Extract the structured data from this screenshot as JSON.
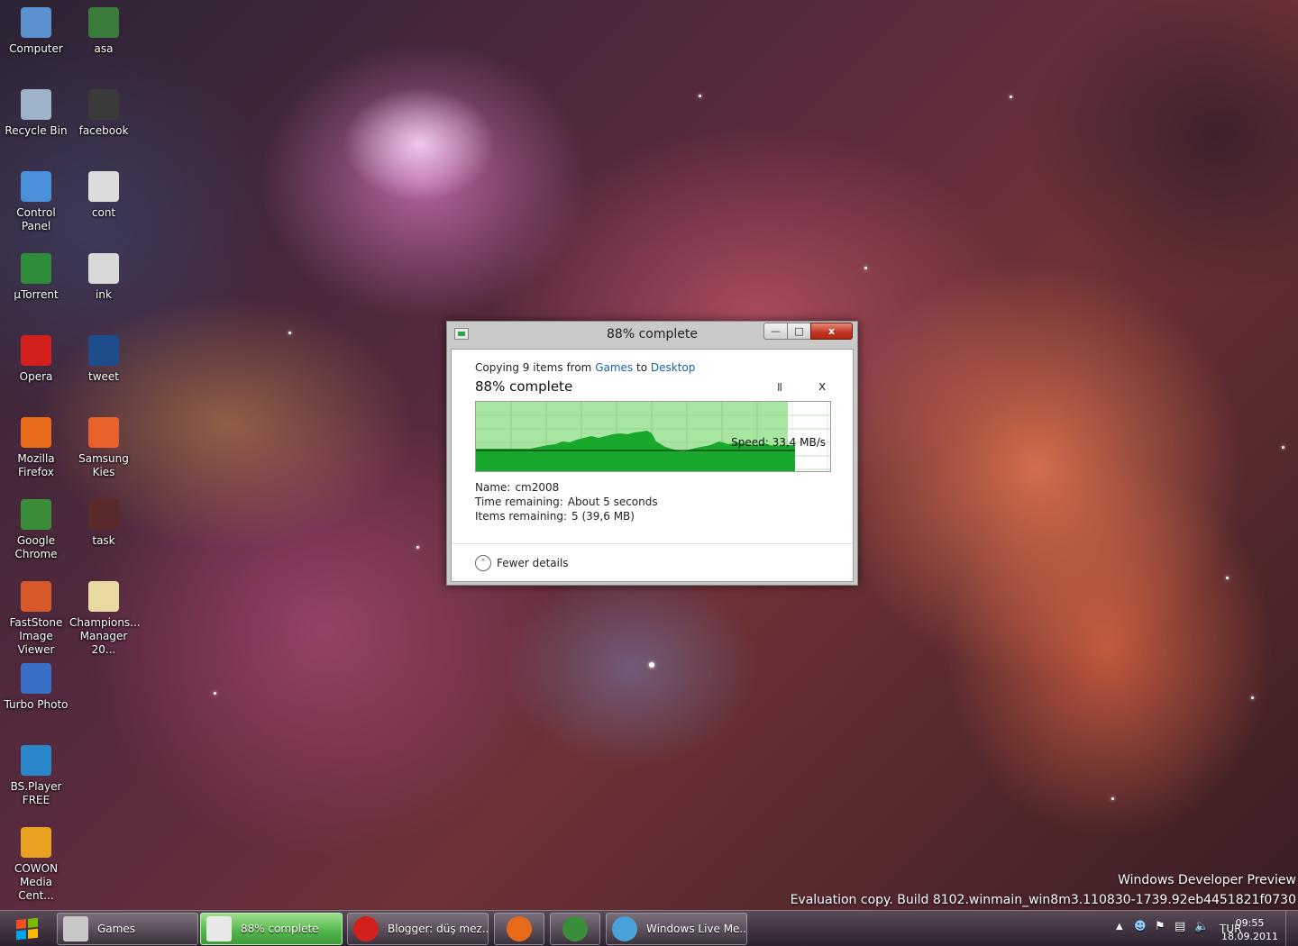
{
  "desktop": {
    "icons_col1": [
      {
        "label": "Computer",
        "icon": "computer-icon",
        "color": "#5a8fd0"
      },
      {
        "label": "Recycle Bin",
        "icon": "recycle-bin-icon",
        "color": "#9fb3c8"
      },
      {
        "label": "Control Panel",
        "icon": "control-panel-icon",
        "color": "#4a90d9"
      },
      {
        "label": "µTorrent",
        "icon": "utorrent-icon",
        "color": "#2e8b3a"
      },
      {
        "label": "Opera",
        "icon": "opera-icon",
        "color": "#d3201c"
      },
      {
        "label": "Mozilla Firefox",
        "icon": "firefox-icon",
        "color": "#e86b1c"
      },
      {
        "label": "Google Chrome",
        "icon": "chrome-icon",
        "color": "#3c8d3a"
      },
      {
        "label": "FastStone Image Viewer",
        "icon": "faststone-icon",
        "color": "#d85a2a"
      },
      {
        "label": "Turbo Photo",
        "icon": "turbo-photo-icon",
        "color": "#3a6fc8"
      },
      {
        "label": "BS.Player FREE",
        "icon": "bsplayer-icon",
        "color": "#2a86c8"
      },
      {
        "label": "COWON Media Cent...",
        "icon": "cowon-icon",
        "color": "#e8a020"
      }
    ],
    "icons_col2": [
      {
        "label": "asa",
        "icon": "image-file-icon",
        "color": "#3a7a3a"
      },
      {
        "label": "facebook",
        "icon": "image-file-icon",
        "color": "#3a3a3a"
      },
      {
        "label": "cont",
        "icon": "image-file-icon",
        "color": "#dcdcdc"
      },
      {
        "label": "ink",
        "icon": "image-file-icon",
        "color": "#d8d8d8"
      },
      {
        "label": "tweet",
        "icon": "image-file-icon",
        "color": "#1f4c8a"
      },
      {
        "label": "Samsung Kies",
        "icon": "samsung-kies-icon",
        "color": "#e8602a"
      },
      {
        "label": "task",
        "icon": "image-file-icon",
        "color": "#5a2a2a"
      },
      {
        "label": "Champions... Manager 20...",
        "icon": "folder-icon",
        "color": "#e8d9a0"
      }
    ]
  },
  "dialog": {
    "title": "88% complete",
    "copying_prefix": "Copying 9 items from",
    "source": "Games",
    "to_word": "to",
    "destination": "Desktop",
    "percent_heading": "88% complete",
    "progress": 0.88,
    "speed": "Speed: 33,4 MB/s",
    "name_label": "Name:",
    "name_value": "cm2008",
    "time_label": "Time remaining:",
    "time_value": "About 5 seconds",
    "items_label": "Items remaining:",
    "items_value": "5 (39,6 MB)",
    "fewer_details": "Fewer details",
    "pause_glyph": "II",
    "stop_glyph": "x",
    "minimize_glyph": "—",
    "maximize_glyph": "□",
    "close_glyph": "x"
  },
  "watermark": {
    "line1": "Windows Developer Preview",
    "line2": "Evaluation copy. Build 8102.winmain_win8m3.110830-1739.92eb4451821f0730"
  },
  "taskbar": {
    "buttons": [
      {
        "label": "Games",
        "icon": "explorer-icon"
      },
      {
        "label": "88% complete",
        "icon": "copy-progress-icon"
      },
      {
        "label": "Blogger: düş mez...",
        "icon": "opera-icon"
      },
      {
        "label": "",
        "icon": "firefox-icon"
      },
      {
        "label": "",
        "icon": "chrome-icon"
      },
      {
        "label": "Windows Live Me...",
        "icon": "windows-live-messenger-icon"
      }
    ],
    "tray": {
      "language": "TUR",
      "time": "09:55",
      "date": "18.09.2011"
    },
    "colors": {
      "copy_active": "#55b84e"
    }
  }
}
